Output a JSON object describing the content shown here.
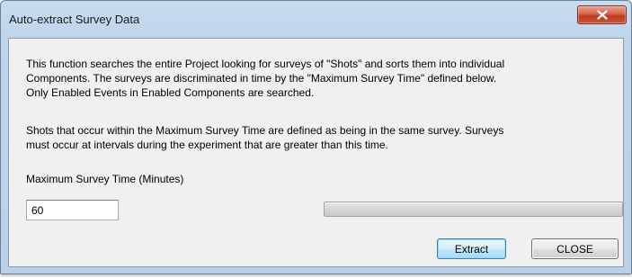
{
  "window": {
    "title": "Auto-extract Survey Data",
    "close_icon": "close-x-icon"
  },
  "description": {
    "paragraph1": [
      "This function searches the entire Project looking for surveys of \"Shots\" and sorts them into individual",
      "Components. The surveys are discriminated in time by the \"Maximum Survey Time\" defined below.",
      "Only Enabled Events in Enabled Components are searched."
    ],
    "paragraph2": [
      "Shots that occur within the Maximum Survey Time are defined as being in the same survey. Surveys",
      "must occur at intervals during the experiment that are greater than this time."
    ]
  },
  "form": {
    "max_time_label": "Maximum Survey Time (Minutes)",
    "max_time_value": "60"
  },
  "progress": {
    "value": 0
  },
  "buttons": {
    "extract_label": "Extract",
    "close_label": "CLOSE"
  },
  "colors": {
    "close_button": "#c13a20",
    "default_button_border": "#3c7fb1",
    "progress_fill": "#06b025"
  }
}
